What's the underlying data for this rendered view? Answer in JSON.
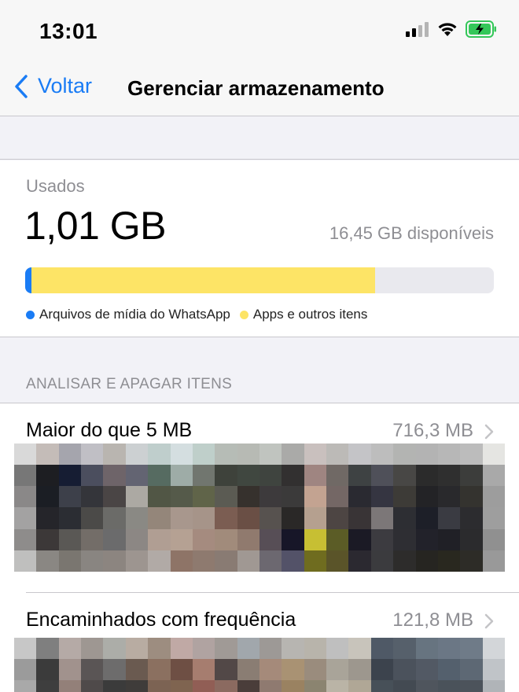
{
  "status": {
    "time": "13:01"
  },
  "nav": {
    "back_label": "Voltar",
    "title": "Gerenciar armazenamento"
  },
  "usage": {
    "used_label": "Usados",
    "used_value": "1,01 GB",
    "available": "16,45 GB disponíveis",
    "bar_fraction": {
      "whatsapp_media": 0.013,
      "apps_other": 0.734
    },
    "legend": [
      {
        "label": "Arquivos de mídia do WhatsApp",
        "color": "#1a7cf5"
      },
      {
        "label": "Apps e outros itens",
        "color": "#fde466"
      }
    ]
  },
  "section": {
    "header": "ANALISAR E APAGAR ITENS"
  },
  "rows": [
    {
      "title": "Maior do que 5 MB",
      "size": "716,3 MB"
    },
    {
      "title": "Encaminhados com frequência",
      "size": "121,8 MB"
    }
  ],
  "colors": {
    "accent": "#1a7cf5",
    "battery": "#34c759"
  },
  "thumbs_row1": [
    [
      "#d9d9d9",
      "#c4bcb8",
      "#a5a5ad",
      "#c0bfc5",
      "#b9b5b0",
      "#ccd0d2",
      "#bfcecc",
      "#d4dee0",
      "#bfcfca",
      "#b6bcb6",
      "#b7bab4",
      "#c0c4bf",
      "#aaaaa8",
      "#c9c0be",
      "#bcbab7",
      "#c4c4c7",
      "#bdbdbd",
      "#b3b4b2",
      "#b3b3b3",
      "#b7b7b7",
      "#bcbcbc",
      "#e5e5e2"
    ],
    [
      "#777777",
      "#1d1e22",
      "#161d33",
      "#4b4e5e",
      "#6e6469",
      "#636472",
      "#566b61",
      "#9eaca7",
      "#71766f",
      "#3e423b",
      "#404740",
      "#3f443f",
      "#323030",
      "#9f8581",
      "#706965",
      "#3e4243",
      "#4f5059",
      "#484745",
      "#2b2b2b",
      "#2f2f2f",
      "#3c3d3b",
      "#a9a9a9"
    ],
    [
      "#8a8888",
      "#1b1e24",
      "#3d404a",
      "#34353a",
      "#4a4545",
      "#aca9a3",
      "#515645",
      "#555a4a",
      "#606449",
      "#5b5b53",
      "#36312d",
      "#3d3a3c",
      "#3b3a3a",
      "#c3a391",
      "#746765",
      "#2a2a31",
      "#353541",
      "#3d3b37",
      "#232326",
      "#29292c",
      "#34332f",
      "#9d9d9d"
    ],
    [
      "#a3a2a2",
      "#25252a",
      "#2b2d33",
      "#4b4a48",
      "#6b6b68",
      "#8a8984",
      "#94867a",
      "#a8978d",
      "#a69489",
      "#7b5d52",
      "#6a4f45",
      "#57524f",
      "#2a2827",
      "#b5a08f",
      "#4d4543",
      "#393436",
      "#7c7778",
      "#2d2e33",
      "#1d1f28",
      "#3a3b42",
      "#2c2c2f",
      "#9e9e9e"
    ],
    [
      "#8e8c8b",
      "#3c3838",
      "#5a5855",
      "#736d68",
      "#6b6b6c",
      "#8c8784",
      "#b09e93",
      "#b5a193",
      "#a58b7f",
      "#a18b7b",
      "#907a6e",
      "#574e56",
      "#171628",
      "#c7bf33",
      "#5b5c26",
      "#1b1a25",
      "#3c3b40",
      "#2e2e33",
      "#22222a",
      "#202026",
      "#2b2b2d",
      "#909090"
    ],
    [
      "#bfbfbe",
      "#8a8783",
      "#7a7670",
      "#898581",
      "#8c8580",
      "#9d9590",
      "#b1aaa6",
      "#8e7467",
      "#8e7a6f",
      "#897b73",
      "#a09893",
      "#6c6870",
      "#535268",
      "#6f6c1f",
      "#5a5429",
      "#2b2930",
      "#3b3b3e",
      "#2d2c2b",
      "#262521",
      "#29281f",
      "#2d2c27",
      "#999999"
    ]
  ],
  "thumbs_row2": [
    [
      "#c7c7c7",
      "#7f7f7f",
      "#b5aaa6",
      "#9e9792",
      "#acada8",
      "#b8aca2",
      "#9d8d80",
      "#c0a9a5",
      "#b0a3a1",
      "#a09a96",
      "#a1a7ac",
      "#9d9996",
      "#b7b5b1",
      "#b8b4ab",
      "#bfbfbf",
      "#c8c4bb",
      "#4f5966",
      "#56606b",
      "#677480",
      "#6b7785",
      "#6f7b88",
      "#d3d6d9"
    ],
    [
      "#9b9b9b",
      "#3b3b3b",
      "#a1928d",
      "#5a5555",
      "#6d6c6c",
      "#6a5a50",
      "#8b7060",
      "#6e4f44",
      "#a67d6f",
      "#524847",
      "#8a7d73",
      "#a58a7a",
      "#a99273",
      "#9a8c7d",
      "#a9a499",
      "#9d978e",
      "#3c434d",
      "#4b525c",
      "#525964",
      "#54606d",
      "#5d6874",
      "#c0c4c8"
    ],
    [
      "#a9a9a9",
      "#3e3e3e",
      "#938079",
      "#4f4a4a",
      "#3b3b3b",
      "#3f3c3a",
      "#7c6353",
      "#7f6450",
      "#915e55",
      "#8b6a60",
      "#4a3d3a",
      "#8f7a70",
      "#9a8261",
      "#8b8470",
      "#bab4a6",
      "#b0a796",
      "#475058",
      "#434a52",
      "#4f555d",
      "#4a525a",
      "#4c535b",
      "#b0b4b8"
    ]
  ]
}
